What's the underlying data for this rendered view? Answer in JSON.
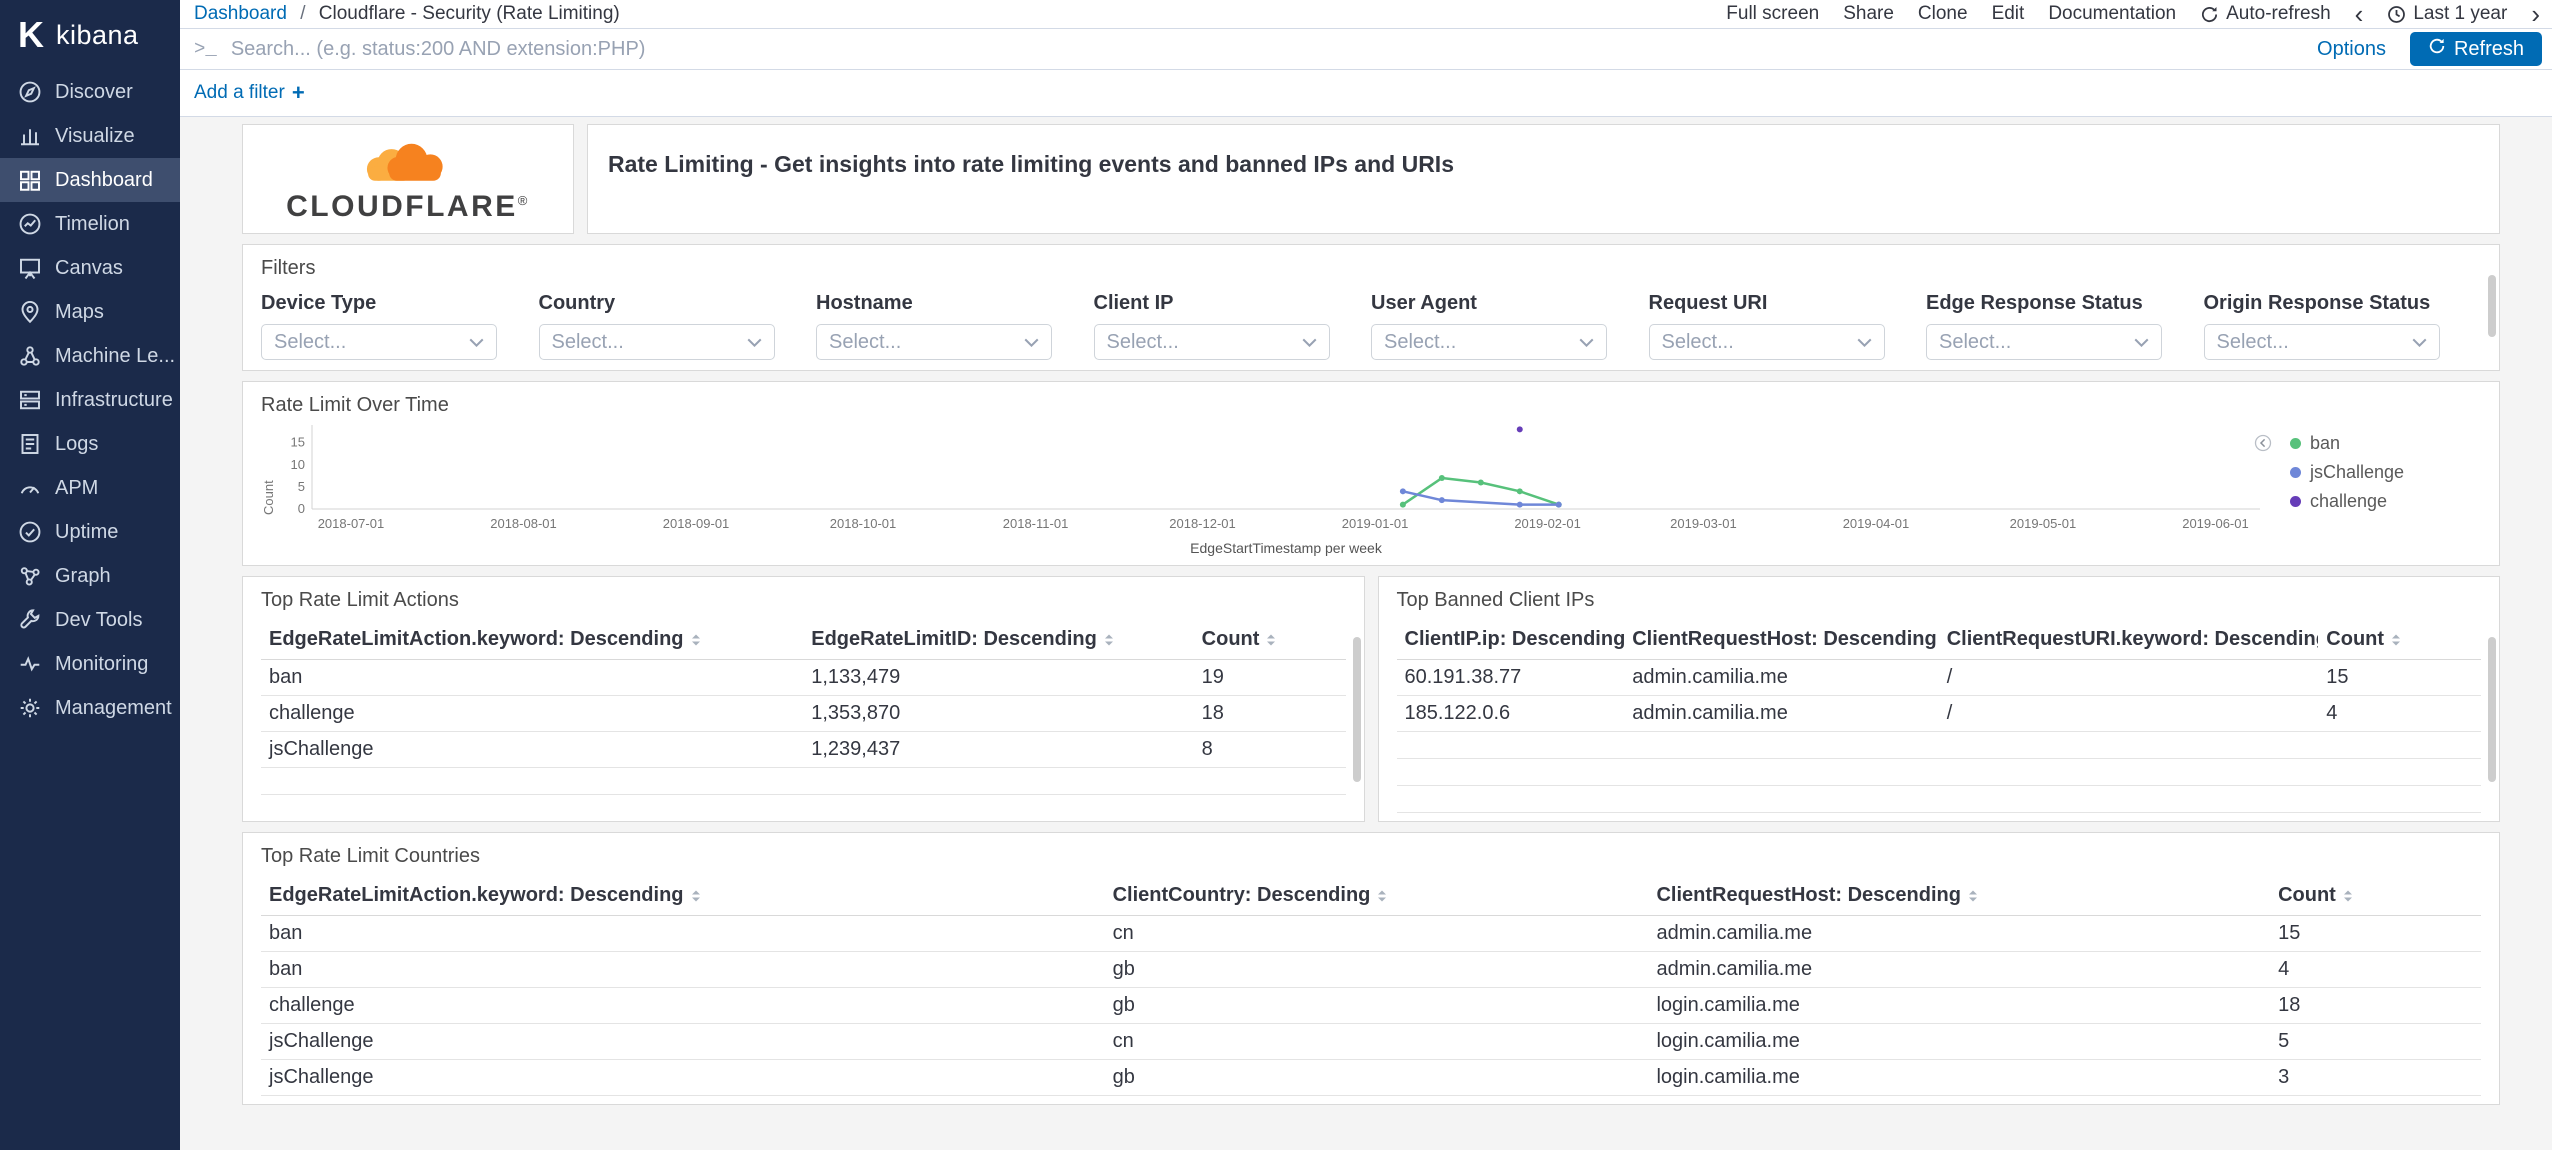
{
  "sidebar": {
    "logo_mark": "K",
    "logo_text": "kibana",
    "items": [
      {
        "id": "discover",
        "label": "Discover",
        "icon": "discover-icon",
        "active": false
      },
      {
        "id": "visualize",
        "label": "Visualize",
        "icon": "visualize-icon",
        "active": false
      },
      {
        "id": "dashboard",
        "label": "Dashboard",
        "icon": "dashboard-icon",
        "active": true
      },
      {
        "id": "timelion",
        "label": "Timelion",
        "icon": "timelion-icon",
        "active": false
      },
      {
        "id": "canvas",
        "label": "Canvas",
        "icon": "canvas-icon",
        "active": false
      },
      {
        "id": "maps",
        "label": "Maps",
        "icon": "maps-icon",
        "active": false
      },
      {
        "id": "machine-learning",
        "label": "Machine Le...",
        "icon": "machine-learning-icon",
        "active": false
      },
      {
        "id": "infrastructure",
        "label": "Infrastructure",
        "icon": "infrastructure-icon",
        "active": false
      },
      {
        "id": "logs",
        "label": "Logs",
        "icon": "logs-icon",
        "active": false
      },
      {
        "id": "apm",
        "label": "APM",
        "icon": "apm-icon",
        "active": false
      },
      {
        "id": "uptime",
        "label": "Uptime",
        "icon": "uptime-icon",
        "active": false
      },
      {
        "id": "graph",
        "label": "Graph",
        "icon": "graph-icon",
        "active": false
      },
      {
        "id": "dev-tools",
        "label": "Dev Tools",
        "icon": "dev-tools-icon",
        "active": false
      },
      {
        "id": "monitoring",
        "label": "Monitoring",
        "icon": "monitoring-icon",
        "active": false
      },
      {
        "id": "management",
        "label": "Management",
        "icon": "management-icon",
        "active": false
      }
    ]
  },
  "header": {
    "breadcrumb": {
      "root": "Dashboard",
      "separator": "/",
      "current": "Cloudflare - Security (Rate Limiting)"
    },
    "menu_items": [
      "Full screen",
      "Share",
      "Clone",
      "Edit",
      "Documentation"
    ],
    "auto_refresh": {
      "label": "Auto-refresh",
      "icon": "auto-refresh-icon"
    },
    "time_picker": {
      "back_icon": "chevron-left-icon",
      "clock_icon": "clock-icon",
      "label": "Last 1 year",
      "forward_icon": "chevron-right-icon"
    }
  },
  "query_bar": {
    "prompt": ">_",
    "prompt_icon": "terminal-prompt-icon",
    "placeholder": "Search... (e.g. status:200 AND extension:PHP)",
    "options_label": "Options",
    "refresh_label": "Refresh",
    "refresh_icon": "refresh-icon"
  },
  "filter_row": {
    "add_filter_label": "Add a filter",
    "plus_label": "+",
    "plus_icon": "plus-icon"
  },
  "cloudflare": {
    "wordmark": "CLOUDFLARE",
    "registered": "®",
    "cloud_icon": "cloudflare-cloud-icon",
    "cloud_front_color": "#F6821F",
    "cloud_back_color": "#FBAD41",
    "text_color": "#404041"
  },
  "markdown_panel": {
    "text": "Rate Limiting - Get insights into rate limiting events and banned IPs and URIs"
  },
  "filters_panel": {
    "title": "Filters",
    "select_placeholder": "Select...",
    "fields": [
      "Device Type",
      "Country",
      "Hostname",
      "Client IP",
      "User Agent",
      "Request URI",
      "Edge Response Status",
      "Origin Response Status"
    ]
  },
  "chart_panel": {
    "title": "Rate Limit Over Time",
    "legend_toggle_icon": "legend-toggle-icon"
  },
  "chart_data": {
    "type": "line",
    "title": "Rate Limit Over Time",
    "xlabel": "EdgeStartTimestamp per week",
    "ylabel": "Count",
    "x_ticks": [
      "2018-07-01",
      "2018-08-01",
      "2018-09-01",
      "2018-10-01",
      "2018-11-01",
      "2018-12-01",
      "2019-01-01",
      "2019-02-01",
      "2019-03-01",
      "2019-04-01",
      "2019-05-01",
      "2019-06-01"
    ],
    "x_domain": [
      "2018-06-24",
      "2019-06-09"
    ],
    "y_ticks": [
      0,
      5,
      10,
      15
    ],
    "y_domain": [
      0,
      19
    ],
    "grid": false,
    "legend_position": "right",
    "series": [
      {
        "name": "ban",
        "color": "#57c17b",
        "points": [
          [
            "2019-01-06",
            1
          ],
          [
            "2019-01-13",
            7
          ],
          [
            "2019-01-20",
            6
          ],
          [
            "2019-01-27",
            4
          ],
          [
            "2019-02-03",
            1
          ]
        ]
      },
      {
        "name": "jsChallenge",
        "color": "#6f87d8",
        "points": [
          [
            "2019-01-06",
            4
          ],
          [
            "2019-01-13",
            2
          ],
          [
            "2019-01-27",
            1
          ],
          [
            "2019-02-03",
            1
          ]
        ]
      },
      {
        "name": "challenge",
        "color": "#663db8",
        "points": [
          [
            "2019-01-27",
            18
          ]
        ]
      }
    ]
  },
  "tables": {
    "actions": {
      "title": "Top Rate Limit Actions",
      "columns": [
        "EdgeRateLimitAction.keyword: Descending",
        "EdgeRateLimitID: Descending",
        "Count"
      ],
      "rows": [
        [
          "ban",
          "1,133,479",
          "19"
        ],
        [
          "challenge",
          "1,353,870",
          "18"
        ],
        [
          "jsChallenge",
          "1,239,437",
          "8"
        ]
      ]
    },
    "banned_ips": {
      "title": "Top Banned Client IPs",
      "columns": [
        "ClientIP.ip: Descending",
        "ClientRequestHost: Descending",
        "ClientRequestURI.keyword: Descending",
        "Count"
      ],
      "rows": [
        [
          "60.191.38.77",
          "admin.camilia.me",
          "/",
          "15"
        ],
        [
          "185.122.0.6",
          "admin.camilia.me",
          "/",
          "4"
        ]
      ]
    },
    "countries": {
      "title": "Top Rate Limit Countries",
      "columns": [
        "EdgeRateLimitAction.keyword: Descending",
        "ClientCountry: Descending",
        "ClientRequestHost: Descending",
        "Count"
      ],
      "rows": [
        [
          "ban",
          "cn",
          "admin.camilia.me",
          "15"
        ],
        [
          "ban",
          "gb",
          "admin.camilia.me",
          "4"
        ],
        [
          "challenge",
          "gb",
          "login.camilia.me",
          "18"
        ],
        [
          "jsChallenge",
          "cn",
          "login.camilia.me",
          "5"
        ],
        [
          "jsChallenge",
          "gb",
          "login.camilia.me",
          "3"
        ]
      ]
    }
  },
  "colors": {
    "accent_blue": "#006BB4",
    "sidebar_bg": "#1b2a4a",
    "sidebar_active_bg": "#3e4e6e",
    "dashboard_bg": "#f4f4f4",
    "panel_border": "#D9D9D9"
  }
}
